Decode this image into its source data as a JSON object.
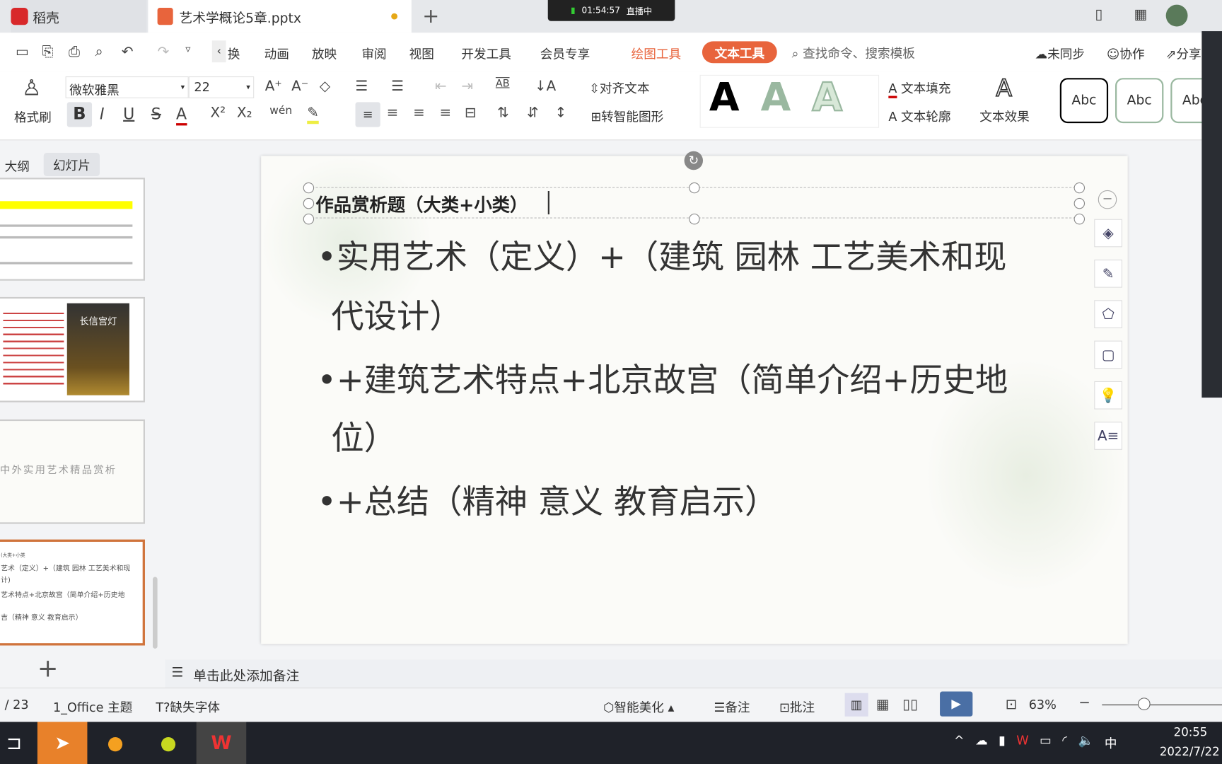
{
  "tabs": [
    {
      "label": "稻壳"
    },
    {
      "label": "艺术学概论5章.pptx"
    }
  ],
  "live": {
    "time": "01:54:57",
    "status": "直播中"
  },
  "menu": [
    "换",
    "动画",
    "放映",
    "审阅",
    "视图",
    "开发工具",
    "会员专享",
    "绘图工具",
    "文本工具"
  ],
  "search": {
    "placeholder": "查找命令、搜索模板"
  },
  "top_right": {
    "sync": "未同步",
    "collab": "协作",
    "share": "分享"
  },
  "ribbon": {
    "format_painter": "格式刷",
    "font_name": "微软雅黑",
    "font_size": "22",
    "align_text": "对齐文本",
    "smart_shape": "转智能图形",
    "text_fill": "文本填充",
    "text_outline": "文本轮廓",
    "text_effect": "文本效果",
    "style_samples": [
      "A",
      "A",
      "A"
    ],
    "shape_styles": [
      "Abc",
      "Abc",
      "Abc"
    ]
  },
  "sidebar": {
    "tabs": [
      "大纲",
      "幻灯片"
    ],
    "thumb3_title": "中外实用艺术精品赏析",
    "thumb2_title": "长信宫灯",
    "thumb4_lines": [
      "(大类+小类",
      "艺术（定义）+（建筑 园林 工艺美术和现",
      "计)",
      "艺术特点+北京故宫（简单介绍+历史地",
      "吉（精神 意义 教育启示）"
    ]
  },
  "slide": {
    "title": "作品赏析题（大类+小类）",
    "bullets": [
      "•实用艺术（定义）+（建筑 园林 工艺美术和现",
      "代设计）",
      "•+建筑艺术特点+北京故宫（简单介绍+历史地",
      "位）",
      "•+总结（精神 意义 教育启示）"
    ]
  },
  "notes": {
    "placeholder": "单击此处添加备注"
  },
  "status": {
    "page": "/ 23",
    "theme": "1_Office 主题",
    "missing_font": "缺失字体",
    "beautify": "智能美化",
    "notes": "备注",
    "comment": "批注",
    "zoom": "63%"
  },
  "taskbar": {
    "time": "20:55",
    "date": "2022/7/22",
    "ime": "中"
  },
  "colors": {
    "accent": "#e8643c",
    "draw_tools": "#e8643c",
    "selected_thumb": "#d0743c"
  }
}
